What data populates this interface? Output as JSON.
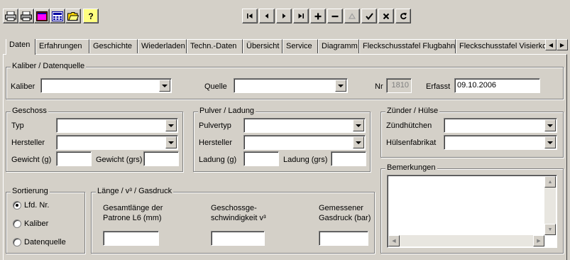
{
  "toolbar": {
    "left_icons": [
      "print-icon",
      "print-preview-icon",
      "image-icon",
      "calculator-icon",
      "open-folder-icon",
      "help-icon"
    ],
    "help_glyph": "?",
    "nav_glyphs": {
      "first": "|◀",
      "prev": "◀",
      "next": "▶",
      "last": "▶|",
      "add": "+",
      "remove": "−",
      "edit": "▲",
      "confirm": "✔",
      "cancel": "✕",
      "refresh": "↻"
    }
  },
  "tabs": [
    {
      "label": "Daten",
      "active": true
    },
    {
      "label": "Erfahrungen"
    },
    {
      "label": "Geschichte"
    },
    {
      "label": "Wiederladen"
    },
    {
      "label": "Techn.-Daten"
    },
    {
      "label": "Übersicht"
    },
    {
      "label": "Service"
    },
    {
      "label": "Diagramm"
    },
    {
      "label": "Fleckschusstafel Flugbahn"
    },
    {
      "label": "Fleckschusstafel Visierkorr"
    }
  ],
  "tab_scroll": {
    "left": "◀",
    "right": "▶"
  },
  "kaliber_group": {
    "title": "Kaliber / Datenquelle",
    "kaliber_label": "Kaliber",
    "kaliber_value": "",
    "quelle_label": "Quelle",
    "quelle_value": "",
    "nr_label": "Nr",
    "nr_value": "1810",
    "erfasst_label": "Erfasst",
    "erfasst_value": "09.10.2006"
  },
  "geschoss": {
    "title": "Geschoss",
    "typ_label": "Typ",
    "typ_value": "",
    "hersteller_label": "Hersteller",
    "hersteller_value": "",
    "gewicht_g_label": "Gewicht (g)",
    "gewicht_g_value": "",
    "gewicht_grs_label": "Gewicht (grs)",
    "gewicht_grs_value": ""
  },
  "pulver": {
    "title": "Pulver / Ladung",
    "typ_label": "Pulvertyp",
    "typ_value": "",
    "hersteller_label": "Hersteller",
    "hersteller_value": "",
    "ladung_g_label": "Ladung (g)",
    "ladung_g_value": "",
    "ladung_grs_label": "Ladung (grs)",
    "ladung_grs_value": ""
  },
  "zuender": {
    "title": "Zünder / Hülse",
    "zuend_label": "Zündhütchen",
    "zuend_value": "",
    "huelse_label": "Hülsenfabrikat",
    "huelse_value": ""
  },
  "bemerkungen": {
    "title": "Bemerkungen",
    "value": ""
  },
  "sortierung": {
    "title": "Sortierung",
    "options": [
      {
        "label": "Lfd. Nr.",
        "checked": true
      },
      {
        "label": "Kaliber",
        "checked": false
      },
      {
        "label": "Datenquelle",
        "checked": false
      }
    ]
  },
  "laenge": {
    "title": "Länge / v³ / Gasdruck",
    "col1_line1": "Gesamtlänge der",
    "col1_line2": "Patrone L6 (mm)",
    "col1_value": "",
    "col2_line1": "Geschossge-",
    "col2_line2": "schwindigkeit v³",
    "col2_value": "",
    "col3_line1": "Gemessener",
    "col3_line2": "Gasdruck (bar)",
    "col3_value": ""
  }
}
